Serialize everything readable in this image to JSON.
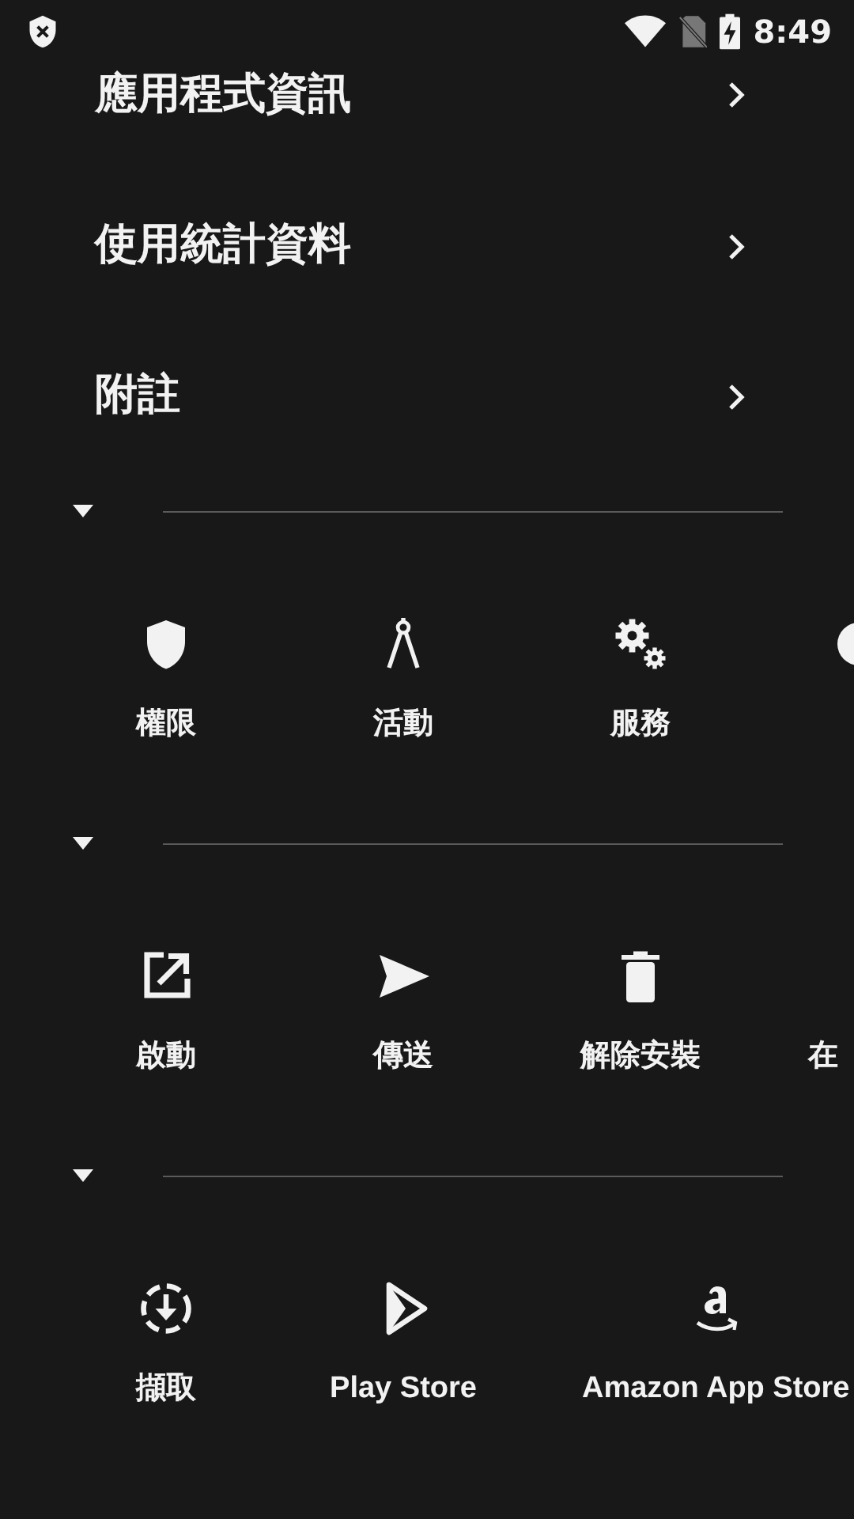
{
  "status_bar": {
    "time": "8:49"
  },
  "menu": [
    {
      "label": "應用程式資訊"
    },
    {
      "label": "使用統計資料"
    },
    {
      "label": "附註"
    }
  ],
  "sections": [
    {
      "expanded": true,
      "items": [
        {
          "kind": "tile",
          "label": "權限"
        },
        {
          "kind": "tile",
          "label": "活動"
        },
        {
          "kind": "tile",
          "label": "服務"
        },
        {
          "kind": "edge-icon"
        }
      ]
    },
    {
      "expanded": true,
      "items": [
        {
          "kind": "tile",
          "label": "啟動"
        },
        {
          "kind": "tile",
          "label": "傳送"
        },
        {
          "kind": "tile",
          "label": "解除安裝"
        },
        {
          "kind": "edge-label",
          "label": "在"
        }
      ]
    },
    {
      "expanded": true,
      "items": [
        {
          "kind": "tile",
          "label": "擷取"
        },
        {
          "kind": "tile",
          "label": "Play Store"
        },
        {
          "kind": "tile",
          "label": "Amazon App Store"
        }
      ]
    }
  ]
}
